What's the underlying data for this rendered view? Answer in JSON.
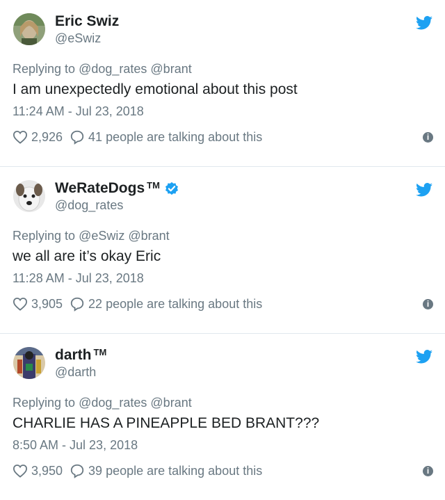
{
  "colors": {
    "brand": "#1da1f2",
    "secondary_text": "#697882",
    "primary_text": "#1c2022",
    "divider": "#e1e8ed"
  },
  "icons": {
    "bird": "twitter-bird-icon",
    "verified": "verified-badge-icon",
    "like": "heart-icon",
    "reply": "speech-bubble-icon",
    "info": "info-icon"
  },
  "tweets": [
    {
      "name": "Eric Swiz",
      "tm": "",
      "verified": false,
      "handle": "@eSwiz",
      "replying_prefix": "Replying to",
      "replying_to": "@dog_rates @brant",
      "text": "I am unexpectedly emotional about this post",
      "timestamp": "11:24 AM - Jul 23, 2018",
      "likes": "2,926",
      "talking": "41 people are talking about this",
      "info": "i"
    },
    {
      "name": "WeRateDogs",
      "tm": "TM",
      "verified": true,
      "handle": "@dog_rates",
      "replying_prefix": "Replying to",
      "replying_to": "@eSwiz @brant",
      "text": "we all are it’s okay Eric",
      "timestamp": "11:28 AM - Jul 23, 2018",
      "likes": "3,905",
      "talking": "22 people are talking about this",
      "info": "i"
    },
    {
      "name": "darth",
      "tm": "TM",
      "verified": false,
      "handle": "@darth",
      "replying_prefix": "Replying to",
      "replying_to": "@dog_rates @brant",
      "text": "CHARLIE HAS A PINEAPPLE BED BRANT???",
      "timestamp": "8:50 AM - Jul 23, 2018",
      "likes": "3,950",
      "talking": "39 people are talking about this",
      "info": "i"
    }
  ]
}
